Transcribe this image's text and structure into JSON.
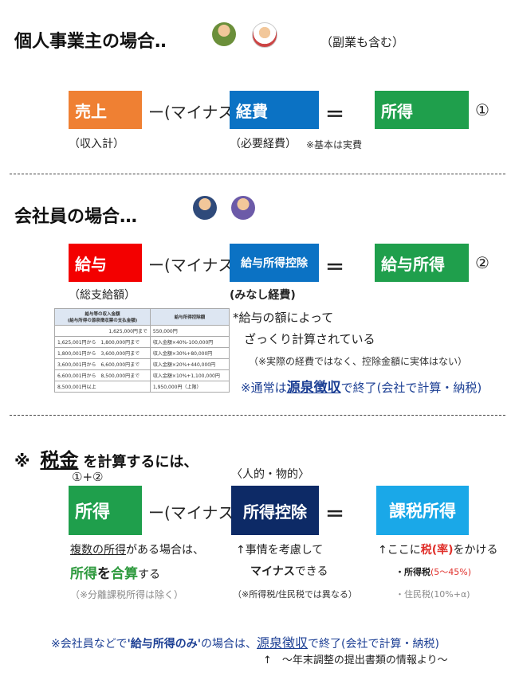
{
  "section1": {
    "title": "個人事業主の場合‥",
    "note": "（副業も含む）",
    "box_uriage": "売上",
    "minus": "ー(マイナス)",
    "box_keihi": "経費",
    "equals": "＝",
    "box_shotoku": "所得",
    "num": "①",
    "label_uriage": "（収入計）",
    "label_keihi": "（必要経費）",
    "label_keihi_note": "※基本は実費"
  },
  "section2": {
    "title": "会社員の場合…",
    "box_kyuyo": "給与",
    "minus": "ー(マイナス)",
    "box_koujo": "給与所得控除",
    "equals": "＝",
    "box_kyuyo_shotoku": "給与所得",
    "num": "②",
    "label_kyuyo": "（総支給額）",
    "label_koujo": "(みなし経費)",
    "line1": "*給与の額によって",
    "line2": "ざっくり計算されている",
    "line3": "（※実際の経費ではなく、控除金額に実体はない）",
    "line4_pre": "※通常は",
    "line4_em": "源泉徴収",
    "line4_post": "で終了(会社で計算・納税)",
    "table": {
      "headers": [
        "給与等の収入金額\n(給与所得の源泉徴収票の支払金額)",
        "給与所得控除額"
      ],
      "rows": [
        [
          "1,625,000円まで",
          "550,000円"
        ],
        [
          "1,625,001円から　1,800,000円まで",
          "収入金額×40%-100,000円"
        ],
        [
          "1,800,001円から　3,600,000円まで",
          "収入金額×30%+80,000円"
        ],
        [
          "3,600,001円から　6,600,000円まで",
          "収入金額×20%+440,000円"
        ],
        [
          "6,600,001円から　8,500,000円まで",
          "収入金額×10%+1,100,000円"
        ],
        [
          "8,500,001円以上",
          "1,950,000円（上限）"
        ]
      ]
    }
  },
  "section3": {
    "title_mark": "※",
    "title_em": "税金",
    "title_rest": "を計算するには、",
    "sub_left": "①+②",
    "sub_right": "〈人的・物的〉",
    "box_shotoku": "所得",
    "minus": "ー(マイナス)",
    "box_koujo": "所得控除",
    "equals": "＝",
    "box_kazei": "課税所得",
    "c1_line1_u": "複数の所得",
    "c1_line1_rest": "がある場合は、",
    "c1_line2_a": "所得",
    "c1_line2_b": "を",
    "c1_line2_c": "合算",
    "c1_line2_d": "する",
    "c1_line3": "（※分離課税所得は除く）",
    "c2_line1": "↑事情を考慮して",
    "c2_line2_a": "マイナス",
    "c2_line2_b": "できる",
    "c2_line3": "（※所得税/住民税では異なる）",
    "c3_line1_a": "↑ここに",
    "c3_line1_b": "税(率)",
    "c3_line1_c": "をかける",
    "c3_line2_a": "・所得税",
    "c3_line2_b": "(5～45%)",
    "c3_line3": "・住民税(10%+α)"
  },
  "footer": {
    "line1_pre": "※会社員などで",
    "line1_q": "'給与所得のみ'",
    "line1_mid": "の場合は、",
    "line1_em": "源泉徴収",
    "line1_post": "で終了(会社で計算・納税)",
    "line2": "↑　～年末調整の提出書類の情報より～"
  },
  "colors": {
    "orange": "#ef8033",
    "blue": "#0b72c4",
    "green": "#1f9f4c",
    "red": "#f30000",
    "navy": "#0d2a66",
    "cyan": "#1aa8e8"
  }
}
